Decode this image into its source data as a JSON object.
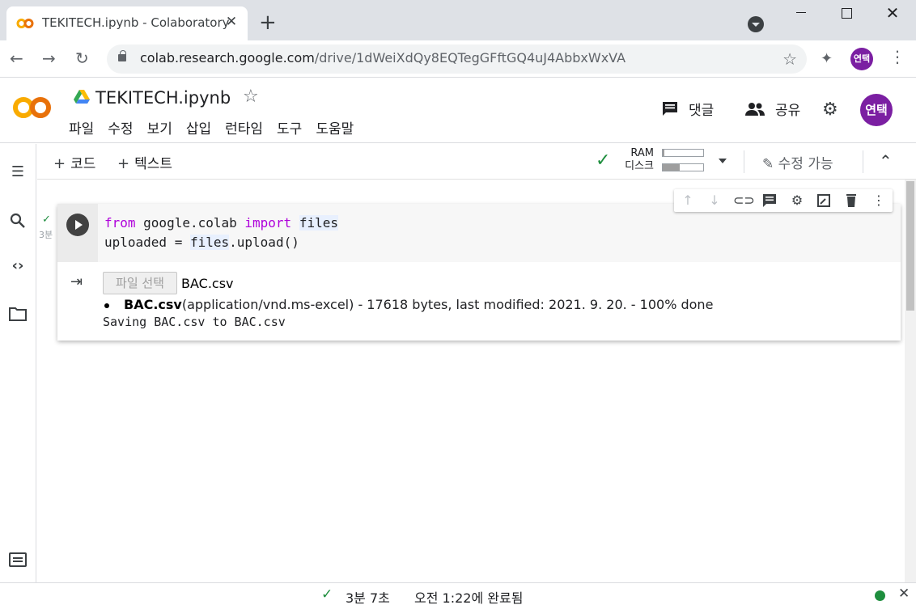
{
  "browser": {
    "tab_title": "TEKITECH.ipynb - Colaboratory",
    "url_host": "colab.research.google.com",
    "url_path": "/drive/1dWeiXdQy8EQTegGFftGQ4uJ4AbbxWxVA",
    "profile_label": "연택"
  },
  "notebook": {
    "title": "TEKITECH.ipynb",
    "menu": [
      "파일",
      "수정",
      "보기",
      "삽입",
      "런타임",
      "도구",
      "도움말"
    ],
    "comment_label": "댓글",
    "share_label": "공유",
    "avatar_label": "연택"
  },
  "cell_toolbar": {
    "add_code": "코드",
    "add_text": "텍스트",
    "ram_label": "RAM",
    "disk_label": "디스크",
    "ram_usage": 0.03,
    "disk_usage": 0.42,
    "edit_label": "수정 가능"
  },
  "cell": {
    "exec_time": "3분",
    "code_line1": {
      "kw1": "from",
      "mod": " google.colab ",
      "kw2": "import",
      "name": "files"
    },
    "code_line2": {
      "pre": "uploaded = ",
      "obj": "files",
      "post": ".upload()"
    },
    "file_button": "파일 선택",
    "file_name": "BAC.csv",
    "upload_bold": "BAC.csv",
    "upload_detail": "(application/vnd.ms-excel) - 17618 bytes, last modified: 2021. 9. 20. - 100% done",
    "saving_text": "Saving BAC.csv to BAC.csv"
  },
  "status": {
    "duration": "3분 7초",
    "completed": "오전 1:22에 완료됨"
  },
  "colors": {
    "accent_orange": "#f9ab00",
    "accent_brown": "#e8710a",
    "success_green": "#1e8e3e",
    "avatar_purple": "#7b1fa2",
    "keyword": "#af00db"
  }
}
